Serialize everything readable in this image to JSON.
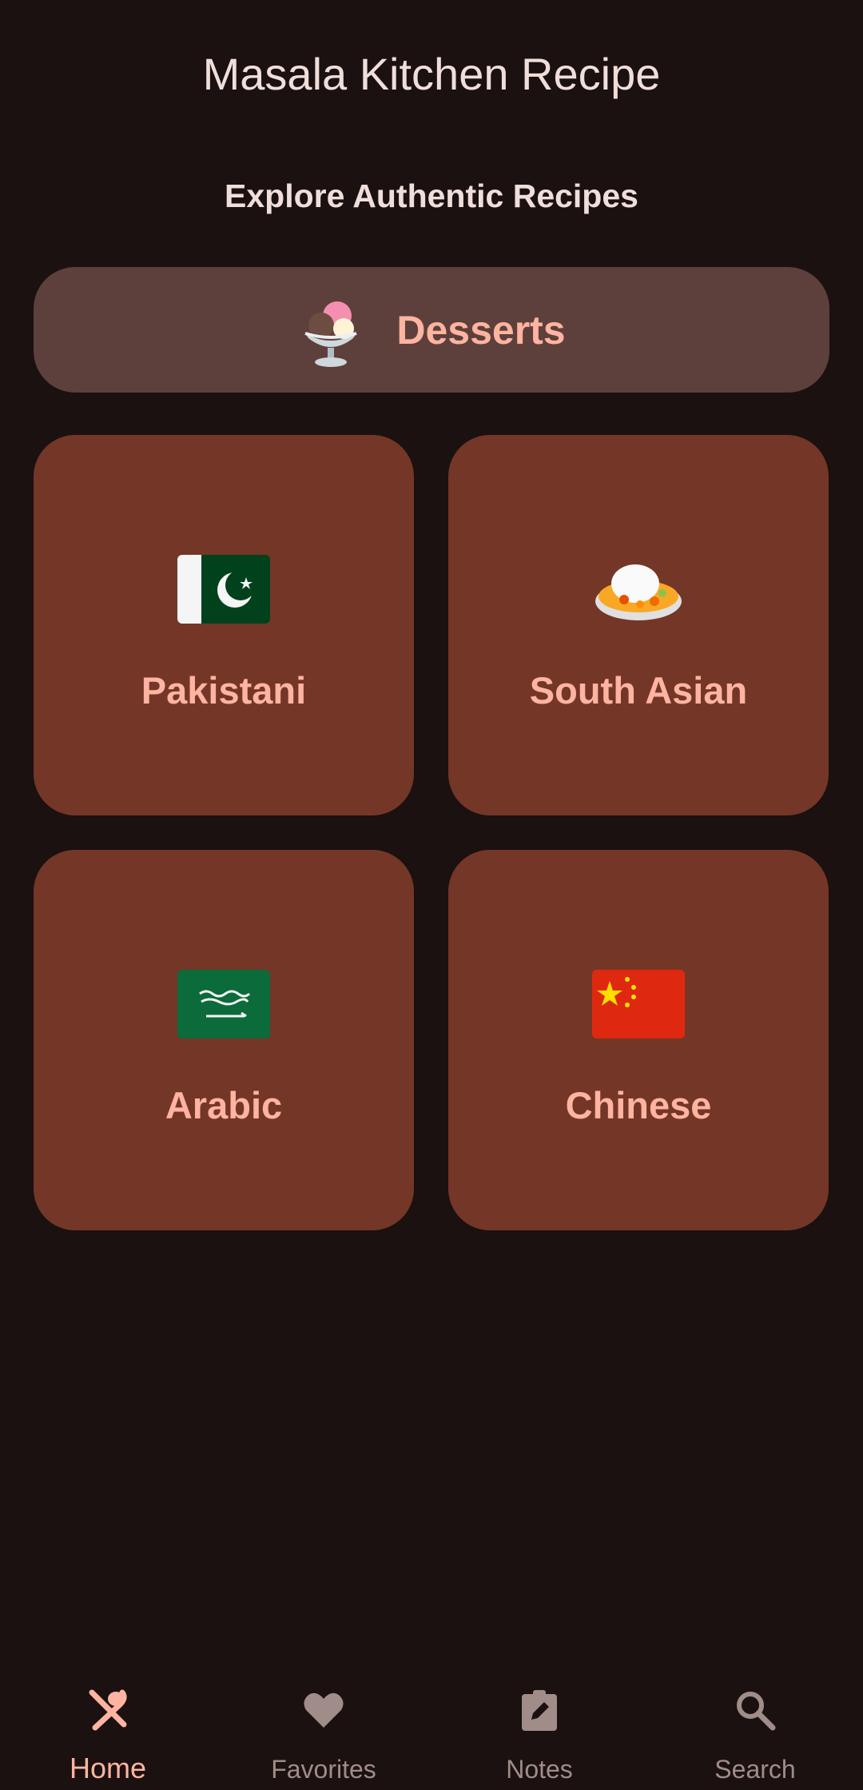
{
  "header": {
    "title": "Masala Kitchen Recipe",
    "subtitle": "Explore Authentic Recipes"
  },
  "featured": {
    "label": "Desserts",
    "icon": "ice-cream-sundae-icon"
  },
  "categories": [
    {
      "label": "Pakistani",
      "icon": "pakistan-flag-icon"
    },
    {
      "label": "South Asian",
      "icon": "curry-rice-icon"
    },
    {
      "label": "Arabic",
      "icon": "saudi-arabia-flag-icon"
    },
    {
      "label": "Chinese",
      "icon": "china-flag-icon"
    }
  ],
  "nav": {
    "items": [
      {
        "label": "Home",
        "icon": "utensils-icon",
        "active": true
      },
      {
        "label": "Favorites",
        "icon": "heart-icon",
        "active": false
      },
      {
        "label": "Notes",
        "icon": "note-edit-icon",
        "active": false
      },
      {
        "label": "Search",
        "icon": "search-icon",
        "active": false
      }
    ]
  },
  "colors": {
    "background": "#1a1110",
    "card": "#743627",
    "featured_card": "#5d403b",
    "accent": "#ffb4a1",
    "nav_inactive": "#a08c89"
  }
}
